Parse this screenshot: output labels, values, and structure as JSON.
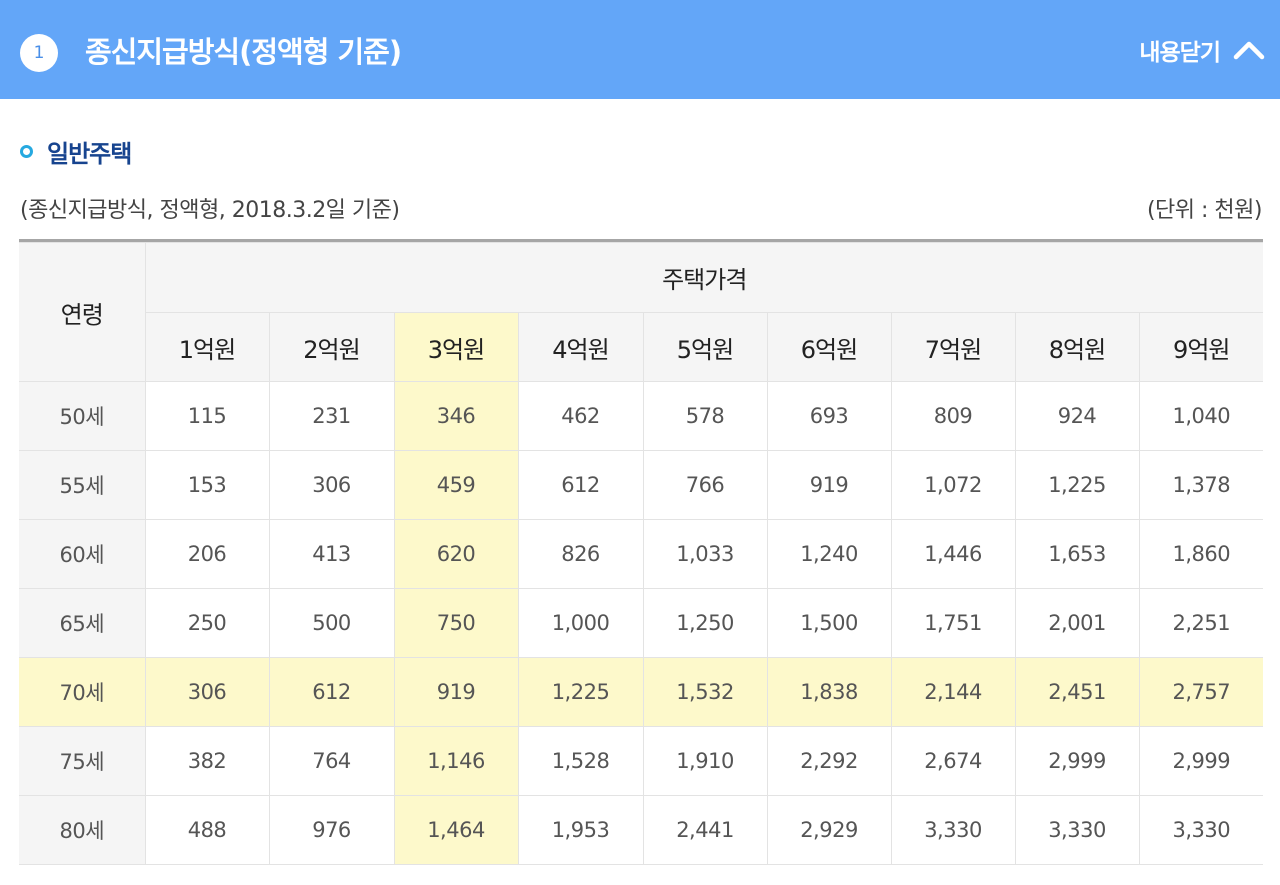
{
  "header": {
    "number": "1",
    "title": "종신지급방식(정액형 기준)",
    "collapse_label": "내용닫기"
  },
  "section": {
    "title": "일반주택"
  },
  "caption": "(종신지급방식, 정액형, 2018.3.2일 기준)",
  "unit": "(단위 : 천원)",
  "table": {
    "age_header": "연령",
    "price_header": "주택가격",
    "columns": [
      "1억원",
      "2억원",
      "3억원",
      "4억원",
      "5억원",
      "6억원",
      "7억원",
      "8억원",
      "9억원"
    ],
    "rows": [
      {
        "age": "50세",
        "values": [
          "115",
          "231",
          "346",
          "462",
          "578",
          "693",
          "809",
          "924",
          "1,040"
        ]
      },
      {
        "age": "55세",
        "values": [
          "153",
          "306",
          "459",
          "612",
          "766",
          "919",
          "1,072",
          "1,225",
          "1,378"
        ]
      },
      {
        "age": "60세",
        "values": [
          "206",
          "413",
          "620",
          "826",
          "1,033",
          "1,240",
          "1,446",
          "1,653",
          "1,860"
        ]
      },
      {
        "age": "65세",
        "values": [
          "250",
          "500",
          "750",
          "1,000",
          "1,250",
          "1,500",
          "1,751",
          "2,001",
          "2,251"
        ]
      },
      {
        "age": "70세",
        "values": [
          "306",
          "612",
          "919",
          "1,225",
          "1,532",
          "1,838",
          "2,144",
          "2,451",
          "2,757"
        ]
      },
      {
        "age": "75세",
        "values": [
          "382",
          "764",
          "1,146",
          "1,528",
          "1,910",
          "2,292",
          "2,674",
          "2,999",
          "2,999"
        ]
      },
      {
        "age": "80세",
        "values": [
          "488",
          "976",
          "1,464",
          "1,953",
          "2,441",
          "2,929",
          "3,330",
          "3,330",
          "3,330"
        ]
      }
    ],
    "highlight": {
      "column": "3억원",
      "row": "70세",
      "cell_value": "919"
    }
  },
  "colors": {
    "header_bg": "#63a6f8",
    "section_title": "#17448f",
    "highlight_yellow": "#fdf9cb",
    "highlight_blue": "#c8f0fb"
  },
  "icons": {
    "badge": "number-badge-icon",
    "collapse": "chevron-up-icon",
    "bullet": "ring-bullet-icon"
  }
}
